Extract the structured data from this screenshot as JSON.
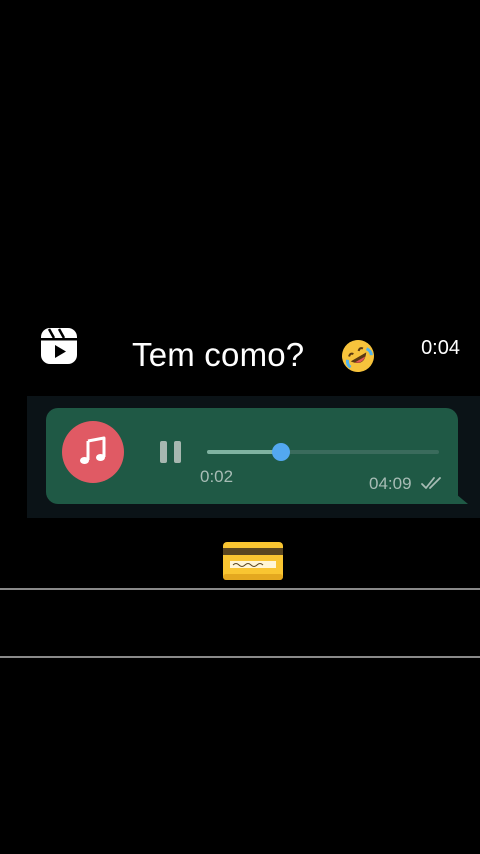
{
  "overlay": {
    "caption": "Tem como?",
    "caption_emoji": "rolling-on-floor-laughing-emoji",
    "timer": "0:04",
    "reels_icon": "reels-icon"
  },
  "voice_message": {
    "avatar_icon": "music-note-icon",
    "avatar_color": "#e05a64",
    "bubble_color": "#1f5945",
    "playback_state": "playing",
    "elapsed": "0:02",
    "progress": 0.32,
    "time": "04:09",
    "status_icon": "double-check-icon"
  },
  "footer": {
    "sticker_icon": "credit-card-emoji"
  }
}
